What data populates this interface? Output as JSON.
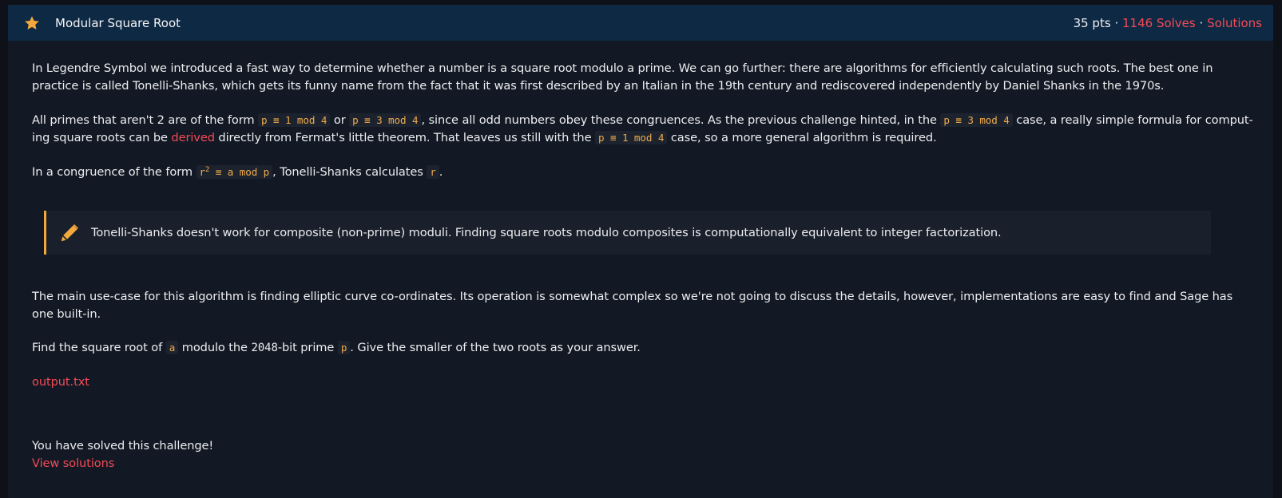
{
  "header": {
    "title": "Modular Square Root",
    "points": "35 pts",
    "separator": "·",
    "solves": "1146 Solves",
    "solutions_link": "Solutions"
  },
  "content": {
    "para1": "In Legendre Symbol we introduced a fast way to determine whether a number is a square root modulo a prime. We can go further: there are algorithms for efficiently calculating such roots. The best one in practice is called Tonelli-Shanks, which gets its funny name from the fact that it was first described by an Italian in the 19th century and rediscovered independently by Daniel Shanks in the 1970s.",
    "para2": {
      "t1": "All primes that aren't 2 are of the form ",
      "c1": "p ≡ 1 mod 4",
      "t2": " or ",
      "c2": "p ≡ 3 mod 4",
      "t3": ", since all odd numbers obey these congruences. As the previous challenge hinted, in the ",
      "c3": "p ≡ 3 mod 4",
      "t4": " case, a really simple formula for comput-ing square roots can be ",
      "link": "derived",
      "t5": " directly from Fermat's little theorem. That leaves us still with the ",
      "c4": "p ≡ 1 mod 4",
      "t6": " case, so a more general algorithm is required."
    },
    "para3": {
      "t1": "In a congruence of the form ",
      "c1_base": "r",
      "c1_exp": "2",
      "c1_rest": " ≡ a mod p",
      "t2": ", Tonelli-Shanks calculates ",
      "c2": "r",
      "t3": "."
    },
    "note": {
      "icon": "pencil-icon",
      "text": "Tonelli-Shanks doesn't work for composite (non-prime) moduli. Finding square roots modulo composites is computationally equivalent to integer factorization."
    },
    "para4": "The main use-case for this algorithm is finding elliptic curve co-ordinates. Its operation is somewhat complex so we're not going to discuss the details, however, implementations are easy to find and Sage has one built-in.",
    "para5": {
      "t1": "Find the square root of ",
      "c1": "a",
      "t2": " modulo the ",
      "num": "2048",
      "t3": "-bit prime ",
      "c2": "p",
      "t4": ". Give the smaller of the two roots as your answer."
    },
    "file_link": "output.txt",
    "solved_text": "You have solved this challenge!",
    "view_solutions": "View solutions"
  },
  "colors": {
    "accent_red": "#f24a56",
    "code_orange": "#f0ab4a",
    "header_bg": "#0e2944",
    "star_gold": "#f2a83b"
  }
}
